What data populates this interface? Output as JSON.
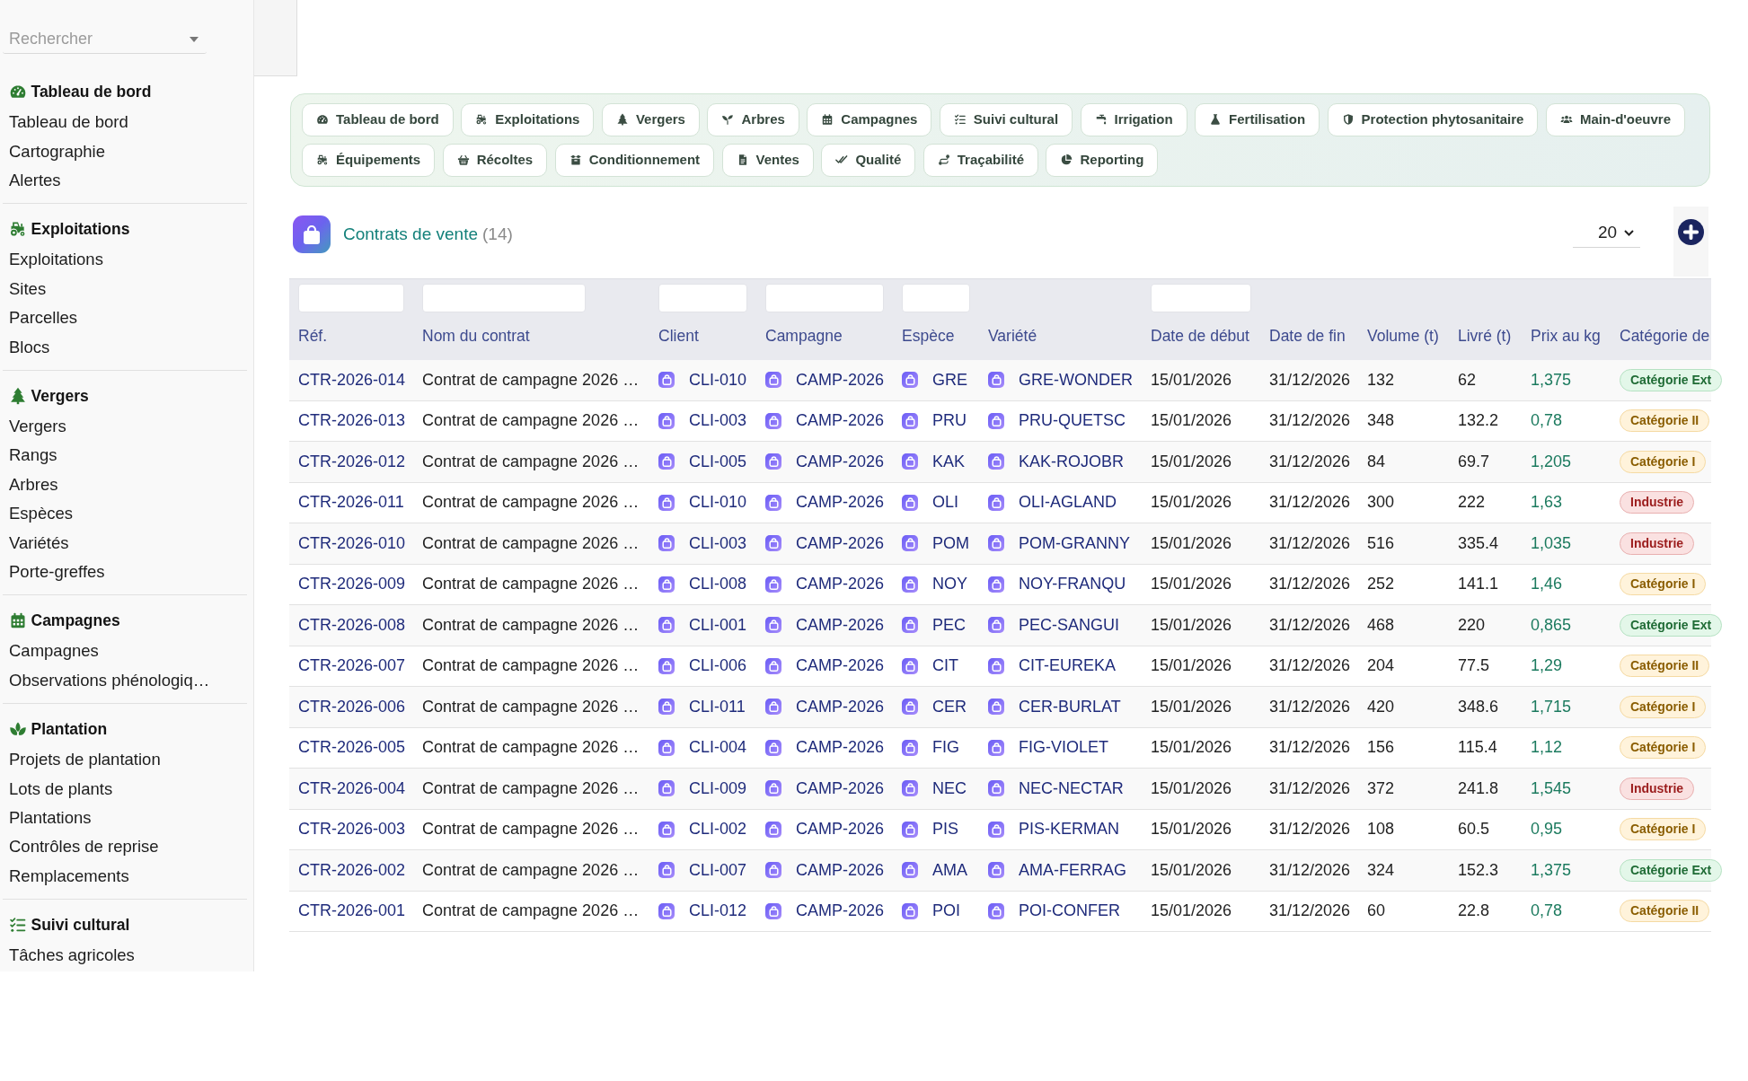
{
  "sidebar": {
    "search": {
      "placeholder": "Rechercher"
    },
    "sections": [
      {
        "title": "Tableau de bord",
        "items": [
          "Tableau de bord",
          "Cartographie",
          "Alertes"
        ]
      },
      {
        "title": "Exploitations",
        "items": [
          "Exploitations",
          "Sites",
          "Parcelles",
          "Blocs"
        ]
      },
      {
        "title": "Vergers",
        "items": [
          "Vergers",
          "Rangs",
          "Arbres",
          "Espèces",
          "Variétés",
          "Porte-greffes"
        ]
      },
      {
        "title": "Campagnes",
        "items": [
          "Campagnes",
          "Observations phénologiq…"
        ]
      },
      {
        "title": "Plantation",
        "items": [
          "Projets de plantation",
          "Lots de plants",
          "Plantations",
          "Contrôles de reprise",
          "Remplacements"
        ]
      },
      {
        "title": "Suivi cultural",
        "items": [
          "Tâches agricoles"
        ]
      }
    ]
  },
  "nav": {
    "rows": [
      [
        "Tableau de bord",
        "Exploitations",
        "Vergers",
        "Arbres",
        "Campagnes",
        "Suivi cultural",
        "Irrigation",
        "Fertilisation",
        "Protection phytosanitaire",
        "Main-d'oeuvre"
      ],
      [
        "Équipements",
        "Récoltes",
        "Conditionnement",
        "Ventes",
        "Qualité",
        "Traçabilité",
        "Reporting"
      ]
    ]
  },
  "page_header": {
    "title": "Contrats de vente",
    "count": "(14)",
    "page_size": "20"
  },
  "table": {
    "columns": [
      {
        "label": "Réf.",
        "filter": true
      },
      {
        "label": "Nom du contrat",
        "filter": true
      },
      {
        "label": "Client",
        "filter": true
      },
      {
        "label": "Campagne",
        "filter": true
      },
      {
        "label": "Espèce",
        "filter": true
      },
      {
        "label": "Variété",
        "filter": false
      },
      {
        "label": "Date de début",
        "filter": true
      },
      {
        "label": "Date de fin",
        "filter": false
      },
      {
        "label": "Volume (t)",
        "filter": false
      },
      {
        "label": "Livré (t)",
        "filter": false
      },
      {
        "label": "Prix au kg",
        "filter": false
      },
      {
        "label": "Catégorie de",
        "filter": false
      }
    ],
    "rows": [
      {
        "ref": "CTR-2026-014",
        "name": "Contrat de campagne 2026 …",
        "client": "CLI-010",
        "campaign": "CAMP-2026",
        "species": "GRE",
        "variety": "GRE-WONDER",
        "start": "15/01/2026",
        "end": "31/12/2026",
        "volume": "132",
        "delivered": "62",
        "price": "1,375",
        "category": {
          "label": "Catégorie Ext",
          "color": "#1f6b35"
        }
      },
      {
        "ref": "CTR-2026-013",
        "name": "Contrat de campagne 2026 …",
        "client": "CLI-003",
        "campaign": "CAMP-2026",
        "species": "PRU",
        "variety": "PRU-QUETSC",
        "start": "15/01/2026",
        "end": "31/12/2026",
        "volume": "348",
        "delivered": "132.2",
        "price": "0,78",
        "category": {
          "label": "Catégorie II",
          "color": "#8a5d00"
        }
      },
      {
        "ref": "CTR-2026-012",
        "name": "Contrat de campagne 2026 …",
        "client": "CLI-005",
        "campaign": "CAMP-2026",
        "species": "KAK",
        "variety": "KAK-ROJOBR",
        "start": "15/01/2026",
        "end": "31/12/2026",
        "volume": "84",
        "delivered": "69.7",
        "price": "1,205",
        "category": {
          "label": "Catégorie I",
          "color": "#8a5d00"
        }
      },
      {
        "ref": "CTR-2026-011",
        "name": "Contrat de campagne 2026 …",
        "client": "CLI-010",
        "campaign": "CAMP-2026",
        "species": "OLI",
        "variety": "OLI-AGLAND",
        "start": "15/01/2026",
        "end": "31/12/2026",
        "volume": "300",
        "delivered": "222",
        "price": "1,63",
        "category": {
          "label": "Industrie",
          "color": "#9b1c1c"
        }
      },
      {
        "ref": "CTR-2026-010",
        "name": "Contrat de campagne 2026 …",
        "client": "CLI-003",
        "campaign": "CAMP-2026",
        "species": "POM",
        "variety": "POM-GRANNY",
        "start": "15/01/2026",
        "end": "31/12/2026",
        "volume": "516",
        "delivered": "335.4",
        "price": "1,035",
        "category": {
          "label": "Industrie",
          "color": "#9b1c1c"
        }
      },
      {
        "ref": "CTR-2026-009",
        "name": "Contrat de campagne 2026 …",
        "client": "CLI-008",
        "campaign": "CAMP-2026",
        "species": "NOY",
        "variety": "NOY-FRANQU",
        "start": "15/01/2026",
        "end": "31/12/2026",
        "volume": "252",
        "delivered": "141.1",
        "price": "1,46",
        "category": {
          "label": "Catégorie I",
          "color": "#8a5d00"
        }
      },
      {
        "ref": "CTR-2026-008",
        "name": "Contrat de campagne 2026 …",
        "client": "CLI-001",
        "campaign": "CAMP-2026",
        "species": "PEC",
        "variety": "PEC-SANGUI",
        "start": "15/01/2026",
        "end": "31/12/2026",
        "volume": "468",
        "delivered": "220",
        "price": "0,865",
        "category": {
          "label": "Catégorie Ext",
          "color": "#1f6b35"
        }
      },
      {
        "ref": "CTR-2026-007",
        "name": "Contrat de campagne 2026 …",
        "client": "CLI-006",
        "campaign": "CAMP-2026",
        "species": "CIT",
        "variety": "CIT-EUREKA",
        "start": "15/01/2026",
        "end": "31/12/2026",
        "volume": "204",
        "delivered": "77.5",
        "price": "1,29",
        "category": {
          "label": "Catégorie II",
          "color": "#8a5d00"
        }
      },
      {
        "ref": "CTR-2026-006",
        "name": "Contrat de campagne 2026 …",
        "client": "CLI-011",
        "campaign": "CAMP-2026",
        "species": "CER",
        "variety": "CER-BURLAT",
        "start": "15/01/2026",
        "end": "31/12/2026",
        "volume": "420",
        "delivered": "348.6",
        "price": "1,715",
        "category": {
          "label": "Catégorie I",
          "color": "#8a5d00"
        }
      },
      {
        "ref": "CTR-2026-005",
        "name": "Contrat de campagne 2026 …",
        "client": "CLI-004",
        "campaign": "CAMP-2026",
        "species": "FIG",
        "variety": "FIG-VIOLET",
        "start": "15/01/2026",
        "end": "31/12/2026",
        "volume": "156",
        "delivered": "115.4",
        "price": "1,12",
        "category": {
          "label": "Catégorie I",
          "color": "#8a5d00"
        }
      },
      {
        "ref": "CTR-2026-004",
        "name": "Contrat de campagne 2026 …",
        "client": "CLI-009",
        "campaign": "CAMP-2026",
        "species": "NEC",
        "variety": "NEC-NECTAR",
        "start": "15/01/2026",
        "end": "31/12/2026",
        "volume": "372",
        "delivered": "241.8",
        "price": "1,545",
        "category": {
          "label": "Industrie",
          "color": "#9b1c1c"
        }
      },
      {
        "ref": "CTR-2026-003",
        "name": "Contrat de campagne 2026 …",
        "client": "CLI-002",
        "campaign": "CAMP-2026",
        "species": "PIS",
        "variety": "PIS-KERMAN",
        "start": "15/01/2026",
        "end": "31/12/2026",
        "volume": "108",
        "delivered": "60.5",
        "price": "0,95",
        "category": {
          "label": "Catégorie I",
          "color": "#8a5d00"
        }
      },
      {
        "ref": "CTR-2026-002",
        "name": "Contrat de campagne 2026 …",
        "client": "CLI-007",
        "campaign": "CAMP-2026",
        "species": "AMA",
        "variety": "AMA-FERRAG",
        "start": "15/01/2026",
        "end": "31/12/2026",
        "volume": "324",
        "delivered": "152.3",
        "price": "1,375",
        "category": {
          "label": "Catégorie Ext",
          "color": "#1f6b35"
        }
      },
      {
        "ref": "CTR-2026-001",
        "name": "Contrat de campagne 2026 …",
        "client": "CLI-012",
        "campaign": "CAMP-2026",
        "species": "POI",
        "variety": "POI-CONFER",
        "start": "15/01/2026",
        "end": "31/12/2026",
        "volume": "60",
        "delivered": "22.8",
        "price": "0,78",
        "category": {
          "label": "Catégorie II",
          "color": "#8a5d00"
        }
      }
    ]
  }
}
